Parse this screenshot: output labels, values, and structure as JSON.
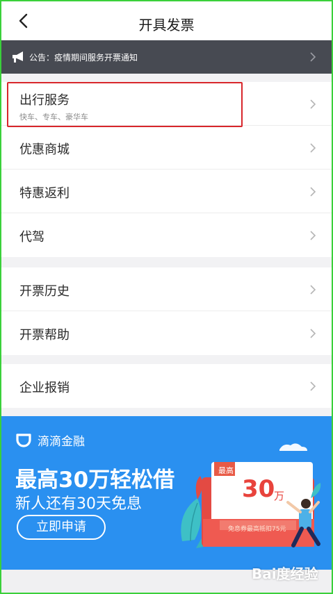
{
  "header": {
    "title": "开具发票"
  },
  "notice": {
    "text": "公告：疫情期间服务开票通知"
  },
  "sections": [
    {
      "items": [
        {
          "label": "出行服务",
          "sub": "快车、专车、豪华车"
        },
        {
          "label": "优惠商城"
        },
        {
          "label": "特惠返利"
        },
        {
          "label": "代驾"
        }
      ]
    },
    {
      "items": [
        {
          "label": "开票历史"
        },
        {
          "label": "开票帮助"
        }
      ]
    },
    {
      "items": [
        {
          "label": "企业报销"
        }
      ]
    }
  ],
  "banner": {
    "brand": "滴滴金融",
    "headline": "最高30万轻松借",
    "subline": "新人还有30天免息",
    "button": "立即申请",
    "card_tag": "最高",
    "card_amount": "30",
    "card_unit": "万",
    "card_note": "免息券最高抵扣75元"
  },
  "watermark": "Bai度经验",
  "colors": {
    "notice_bg": "#474a52",
    "banner_bg": "#2a90f0",
    "highlight": "#d8262b",
    "frame": "#3ad03a"
  },
  "icons": [
    "back-arrow-icon",
    "megaphone-icon",
    "chevron-right-icon",
    "didi-logo-icon"
  ]
}
